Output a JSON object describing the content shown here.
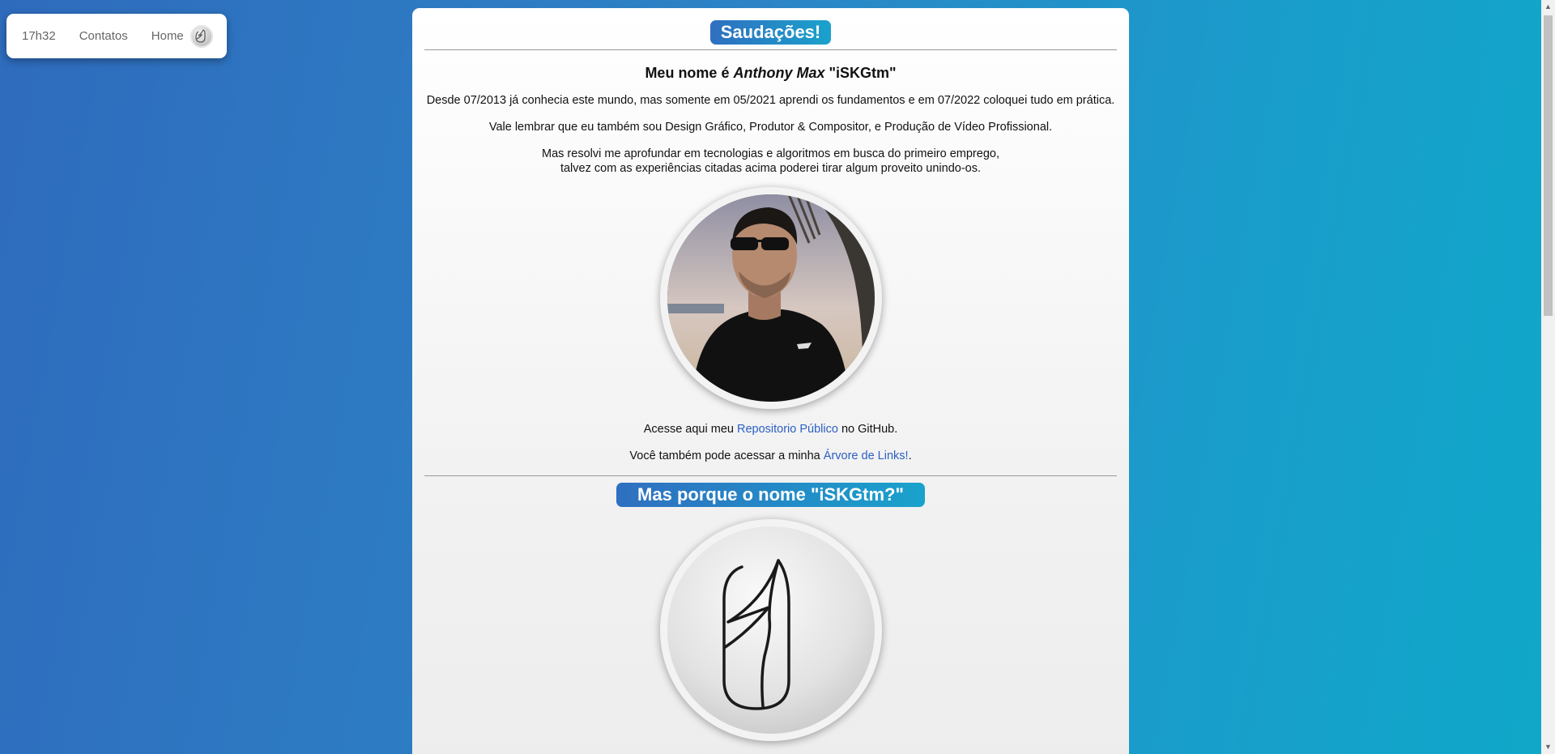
{
  "nav": {
    "time": "17h32",
    "contacts": "Contatos",
    "home": "Home",
    "logo_icon": "feather-logo-icon"
  },
  "greeting": {
    "title": "Saudações!",
    "intro_prefix": "Meu nome é ",
    "intro_name": "Anthony Max",
    "intro_suffix": " \"iSKGtm\"",
    "p1": "Desde 07/2013 já conhecia este mundo, mas somente em 05/2021 aprendi os fundamentos e em 07/2022 coloquei tudo em prática.",
    "p2": "Vale lembrar que eu também sou Design Gráfico, Produtor & Compositor, e Produção de Vídeo Profissional.",
    "p3_line1": "Mas resolvi me aprofundar em tecnologias e algoritmos em busca do primeiro emprego,",
    "p3_line2": "talvez com as experiências citadas acima poderei tirar algum proveito unindo-os.",
    "repo_prefix": "Acesse aqui meu ",
    "repo_link": "Repositorio Público",
    "repo_suffix": " no GitHub.",
    "tree_prefix": "Você também pode acessar a minha ",
    "tree_link": "Árvore de Links!",
    "tree_suffix": "."
  },
  "section2": {
    "title": "Mas porque o nome \"iSKGtm?\""
  },
  "colors": {
    "accent_start": "#2f6fc0",
    "accent_end": "#1aa2cc",
    "link": "#2b5fc4"
  }
}
